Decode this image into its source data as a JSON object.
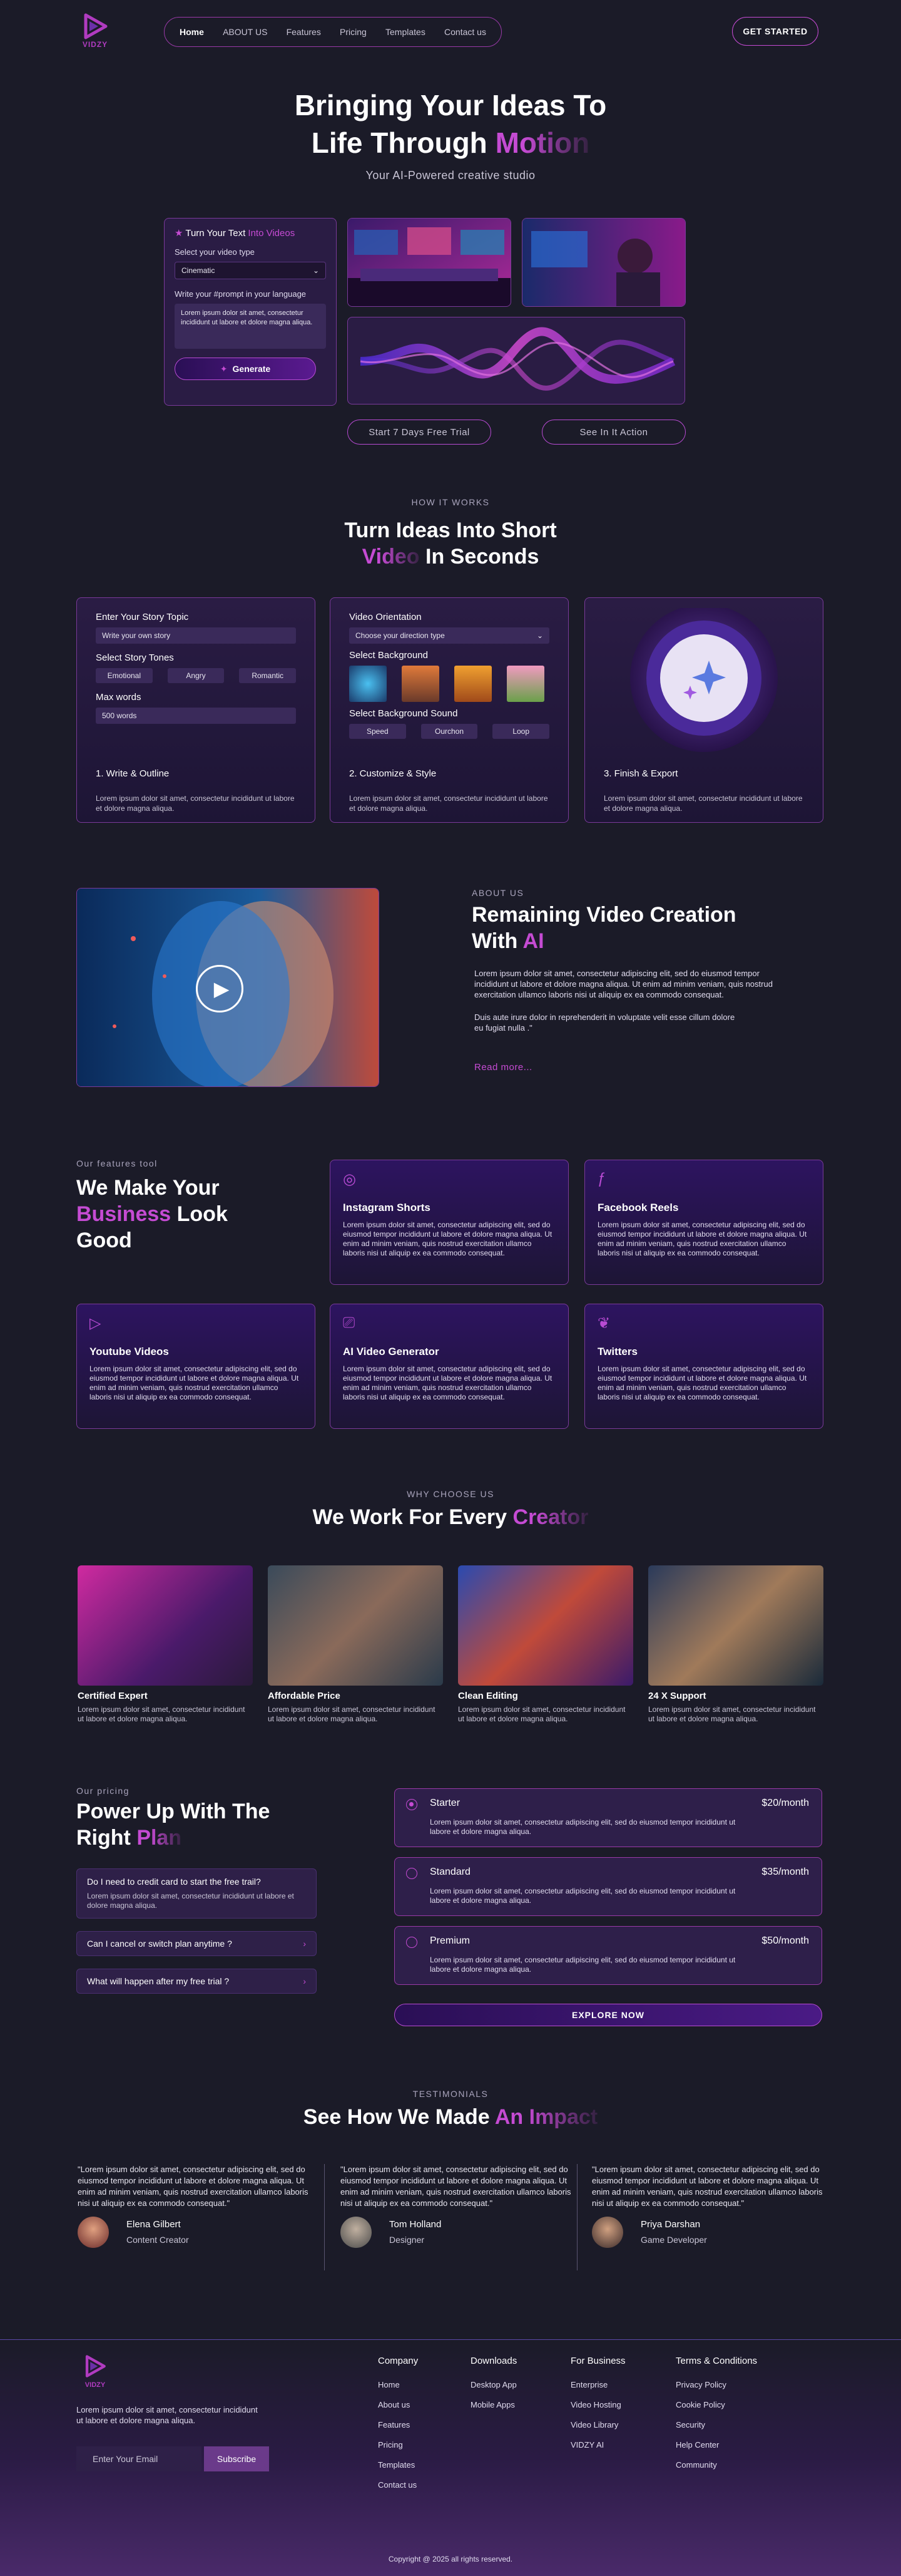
{
  "brand": {
    "logo_text": "VIDZY"
  },
  "nav": {
    "items": [
      "Home",
      "ABOUT US",
      "Features",
      "Pricing",
      "Templates",
      "Contact us"
    ],
    "cta": "GET STARTED"
  },
  "hero": {
    "title_line1": "Bringing Your Ideas To",
    "title_line2_a": "Life Through ",
    "title_line2_b": "Motion",
    "subtitle": "Your AI-Powered creative studio",
    "prompt_card": {
      "title_a": "Turn Your Text ",
      "title_b": "Into Videos",
      "video_type_label": "Select your video type",
      "video_type_value": "Cinematic",
      "prompt_label": "Write your #prompt in your language",
      "prompt_text": "Lorem ipsum dolor sit amet, consectetur incididunt ut labore et dolore magna aliqua.",
      "generate": "Generate"
    },
    "trial_button": "Start 7 Days Free Trial",
    "action_button": "See In It Action"
  },
  "how": {
    "eyebrow": "HOW IT WORKS",
    "title_line1": "Turn Ideas Into Short",
    "title_line2_a": "Video",
    "title_line2_b": " In Seconds",
    "step1": {
      "topic_label": "Enter Your Story Topic",
      "topic_placeholder": "Write your own story",
      "tones_label": "Select Story Tones",
      "tones": [
        "Emotional",
        "Angry",
        "Romantic"
      ],
      "max_label": "Max words",
      "max_value": "500 words",
      "title": "1.  Write & Outline",
      "desc": "Lorem ipsum dolor sit amet, consectetur incididunt ut labore et dolore magna  aliqua."
    },
    "step2": {
      "orient_label": "Video Orientation",
      "orient_value": "Choose your direction type",
      "bg_label": "Select Background",
      "sound_label": "Select Background Sound",
      "sounds": [
        "Speed",
        "Ourchon",
        "Loop"
      ],
      "title": "2.  Customize & Style",
      "desc": "Lorem ipsum dolor sit amet, consectetur incididunt ut labore et dolore magna  aliqua."
    },
    "step3": {
      "title": "3.  Finish & Export",
      "desc": "Lorem ipsum dolor sit amet, consectetur incididunt ut labore et dolore magna  aliqua."
    }
  },
  "about": {
    "eyebrow": "ABOUT US",
    "title_line1": "Remaining Video Creation",
    "title_line2_a": "With ",
    "title_line2_b": "AI",
    "p1": "Lorem ipsum dolor sit amet, consectetur adipiscing elit, sed do eiusmod tempor incididunt ut labore et dolore magna aliqua. Ut enim ad minim veniam, quis nostrud exercitation ullamco laboris nisi ut aliquip ex ea commodo consequat.",
    "p2": "Duis aute irure dolor in reprehenderit in voluptate velit esse cillum dolore eu fugiat nulla .\"",
    "read_more": "Read more..."
  },
  "features": {
    "eyebrow": "Our features tool",
    "title_a": "We Make Your",
    "title_b": "Business",
    "title_c": " Look",
    "title_d": "Good",
    "cards": [
      {
        "title": "Instagram Shorts",
        "desc": "Lorem ipsum dolor sit amet, consectetur adipiscing elit, sed do eiusmod tempor incididunt ut labore et dolore magna aliqua. Ut enim ad minim veniam, quis nostrud exercitation ullamco laboris nisi ut aliquip ex ea commodo consequat."
      },
      {
        "title": "Facebook Reels",
        "desc": "Lorem ipsum dolor sit amet, consectetur adipiscing elit, sed do eiusmod tempor incididunt ut labore et dolore magna aliqua. Ut enim ad minim veniam, quis nostrud exercitation ullamco laboris nisi ut aliquip ex ea commodo consequat."
      },
      {
        "title": "Youtube Videos",
        "desc": "Lorem ipsum dolor sit amet, consectetur adipiscing elit, sed do eiusmod tempor incididunt ut labore et dolore magna aliqua. Ut enim ad minim veniam, quis nostrud exercitation ullamco laboris nisi ut aliquip ex ea commodo consequat."
      },
      {
        "title": "AI Video Generator",
        "desc": "Lorem ipsum dolor sit amet, consectetur adipiscing elit, sed do eiusmod tempor incididunt ut labore et dolore magna aliqua. Ut enim ad minim veniam, quis nostrud exercitation ullamco laboris nisi ut aliquip ex ea commodo consequat."
      },
      {
        "title": "Twitters",
        "desc": "Lorem ipsum dolor sit amet, consectetur adipiscing elit, sed do eiusmod tempor incididunt ut labore et dolore magna aliqua. Ut enim ad minim veniam, quis nostrud exercitation ullamco laboris nisi ut aliquip ex ea commodo consequat."
      }
    ]
  },
  "why": {
    "eyebrow": "WHY CHOOSE US",
    "title_a": "We Work For Every ",
    "title_b": "Creator",
    "items": [
      {
        "title": "Certified Expert",
        "desc": "Lorem ipsum dolor sit amet, consectetur incididunt ut labore et dolore magna  aliqua."
      },
      {
        "title": "Affordable Price",
        "desc": "Lorem ipsum dolor sit amet, consectetur incididunt ut labore et dolore magna  aliqua."
      },
      {
        "title": "Clean Editing",
        "desc": "Lorem ipsum dolor sit amet, consectetur incididunt ut labore et dolore magna  aliqua."
      },
      {
        "title": "24 X Support",
        "desc": "Lorem ipsum dolor sit amet, consectetur incididunt ut labore et dolore magna  aliqua."
      }
    ]
  },
  "pricing": {
    "eyebrow": "Our pricing",
    "title_a": "Power Up With The",
    "title_b": "Right ",
    "title_c": "Plan",
    "faq": [
      {
        "q": "Do I need to credit card to start the free trail?",
        "a": "Lorem ipsum dolor sit amet, consectetur incididunt ut labore et dolore magna  aliqua."
      },
      {
        "q": "Can I cancel or switch plan anytime ?"
      },
      {
        "q": "What will happen after my free trial ?"
      }
    ],
    "plans": [
      {
        "name": "Starter",
        "price": "$20/month",
        "desc": "Lorem ipsum dolor sit amet, consectetur adipiscing elit, sed do eiusmod tempor incididunt ut labore et dolore magna aliqua."
      },
      {
        "name": "Standard",
        "price": "$35/month",
        "desc": "Lorem ipsum dolor sit amet, consectetur adipiscing elit, sed do eiusmod tempor incididunt ut labore et dolore magna aliqua."
      },
      {
        "name": "Premium",
        "price": "$50/month",
        "desc": "Lorem ipsum dolor sit amet, consectetur adipiscing elit, sed do eiusmod tempor incididunt ut labore et dolore magna aliqua."
      }
    ],
    "explore": "EXPLORE NOW"
  },
  "testimonials": {
    "eyebrow": "TESTIMONIALS",
    "title_a": "See How We Made ",
    "title_b": "An Impact",
    "items": [
      {
        "quote": "\"Lorem ipsum dolor sit amet, consectetur adipiscing elit, sed do eiusmod tempor incididunt ut labore et dolore magna aliqua.  Ut enim ad minim veniam, quis nostrud exercitation ullamco laboris nisi ut aliquip ex ea commodo consequat.\"",
        "name": "Elena Gilbert",
        "role": "Content Creator"
      },
      {
        "quote": "\"Lorem ipsum dolor sit amet, consectetur adipiscing elit, sed do eiusmod tempor incididunt ut labore et dolore magna aliqua.  Ut enim ad minim veniam, quis nostrud exercitation ullamco laboris nisi ut aliquip ex ea commodo consequat.\"",
        "name": "Tom Holland",
        "role": "Designer"
      },
      {
        "quote": "\"Lorem ipsum dolor sit amet, consectetur adipiscing elit, sed do eiusmod tempor incididunt ut labore et dolore magna aliqua.  Ut enim ad minim veniam, quis nostrud exercitation ullamco laboris nisi ut aliquip ex ea commodo consequat.\"",
        "name": "Priya Darshan",
        "role": "Game Developer"
      }
    ]
  },
  "footer": {
    "desc": "Lorem ipsum dolor sit amet, consectetur incididunt ut labore et dolore magna  aliqua.",
    "email_placeholder": "Enter Your Email",
    "subscribe": "Subscribe",
    "cols": [
      {
        "title": "Company",
        "links": [
          "Home",
          "About us",
          "Features",
          "Pricing",
          "Templates",
          "Contact us"
        ]
      },
      {
        "title": "Downloads",
        "links": [
          "Desktop App",
          "Mobile Apps"
        ]
      },
      {
        "title": "For Business",
        "links": [
          "Enterprise",
          "Video Hosting",
          "Video Library",
          "VIDZY AI"
        ]
      },
      {
        "title": "Terms & Conditions",
        "links": [
          "Privacy Policy",
          "Cookie Policy",
          "Security",
          "Help Center",
          "Community"
        ]
      }
    ],
    "copyright": "Copyright @ 2025 all rights reserved."
  }
}
